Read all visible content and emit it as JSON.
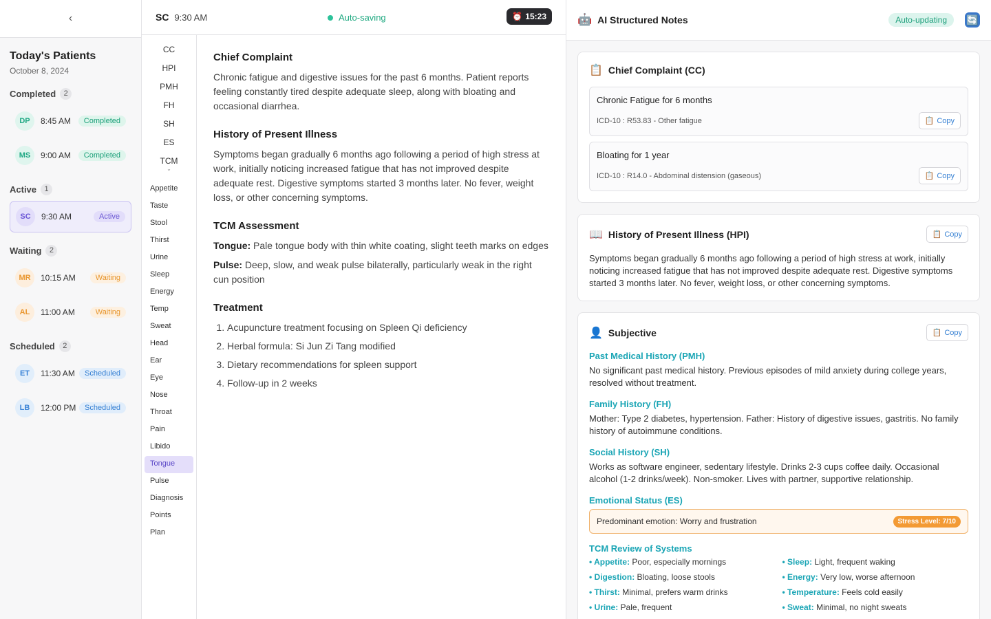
{
  "sidebar": {
    "collapse_glyph": "‹",
    "title": "Today's Patients",
    "date": "October 8, 2024",
    "groups": [
      {
        "label": "Completed",
        "count": "2",
        "patients": [
          {
            "initials": "DP",
            "time": "8:45 AM",
            "status": "Completed"
          },
          {
            "initials": "MS",
            "time": "9:00 AM",
            "status": "Completed"
          }
        ]
      },
      {
        "label": "Active",
        "count": "1",
        "patients": [
          {
            "initials": "SC",
            "time": "9:30 AM",
            "status": "Active"
          }
        ]
      },
      {
        "label": "Waiting",
        "count": "2",
        "patients": [
          {
            "initials": "MR",
            "time": "10:15 AM",
            "status": "Waiting"
          },
          {
            "initials": "AL",
            "time": "11:00 AM",
            "status": "Waiting"
          }
        ]
      },
      {
        "label": "Scheduled",
        "count": "2",
        "patients": [
          {
            "initials": "ET",
            "time": "11:30 AM",
            "status": "Scheduled"
          },
          {
            "initials": "LB",
            "time": "12:00 PM",
            "status": "Scheduled"
          }
        ]
      }
    ]
  },
  "editor": {
    "patient_initials": "SC",
    "patient_time": "9:30 AM",
    "autosave_label": "Auto-saving",
    "timer_icon": "⏰",
    "timer_value": "15:23",
    "section_abbrs": [
      "CC",
      "HPI",
      "PMH",
      "FH",
      "SH",
      "ES",
      "TCM"
    ],
    "tcm_chevron": "⌄",
    "tcm_items": [
      "Appetite",
      "Taste",
      "Stool",
      "Thirst",
      "Urine",
      "Sleep",
      "Energy",
      "Temp",
      "Sweat",
      "Head",
      "Ear",
      "Eye",
      "Nose",
      "Throat",
      "Pain",
      "Libido",
      "Tongue",
      "Pulse",
      "Diagnosis",
      "Points",
      "Plan"
    ],
    "selected_item": "Tongue",
    "cc_heading": "Chief Complaint",
    "cc_text": "Chronic fatigue and digestive issues for the past 6 months. Patient reports feeling constantly tired despite adequate sleep, along with bloating and occasional diarrhea.",
    "hpi_heading": "History of Present Illness",
    "hpi_text": "Symptoms began gradually 6 months ago following a period of high stress at work, initially noticing increased fatigue that has not improved despite adequate rest. Digestive symptoms started 3 months later. No fever, weight loss, or other concerning symptoms.",
    "tcm_heading": "TCM Assessment",
    "tongue_label": "Tongue:",
    "tongue_text": " Pale tongue body with thin white coating, slight teeth marks on edges",
    "pulse_label": "Pulse:",
    "pulse_text": " Deep, slow, and weak pulse bilaterally, particularly weak in the right cun position",
    "treatment_heading": "Treatment",
    "treatment_items": [
      "Acupuncture treatment focusing on Spleen Qi deficiency",
      "Herbal formula: Si Jun Zi Tang modified",
      "Dietary recommendations for spleen support",
      "Follow-up in 2 weeks"
    ]
  },
  "notes": {
    "robot_icon": "🤖",
    "title": "AI Structured Notes",
    "status": "Auto-updating",
    "refresh_icon": "🔄",
    "copy_icon": "📋",
    "copy_label": "Copy",
    "cc_card": {
      "icon": "📋",
      "title": "Chief Complaint (CC)",
      "items": [
        {
          "name": "Chronic Fatigue for 6 months",
          "code": "ICD-10 : R53.83 - Other fatigue"
        },
        {
          "name": "Bloating for 1 year",
          "code": "ICD-10 : R14.0 - Abdominal distension (gaseous)"
        }
      ]
    },
    "hpi_card": {
      "icon": "📖",
      "title": "History of Present Illness (HPI)",
      "text": "Symptoms began gradually 6 months ago following a period of high stress at work, initially noticing increased fatigue that has not improved despite adequate rest. Digestive symptoms started 3 months later. No fever, weight loss, or other concerning symptoms."
    },
    "subjective_card": {
      "icon": "👤",
      "title": "Subjective",
      "pmh_heading": "Past Medical History (PMH)",
      "pmh_text": "No significant past medical history. Previous episodes of mild anxiety during college years, resolved without treatment.",
      "fh_heading": "Family History (FH)",
      "fh_text": "Mother: Type 2 diabetes, hypertension. Father: History of digestive issues, gastritis. No family history of autoimmune conditions.",
      "sh_heading": "Social History (SH)",
      "sh_text": "Works as software engineer, sedentary lifestyle. Drinks 2-3 cups coffee daily. Occasional alcohol (1-2 drinks/week). Non-smoker. Lives with partner, supportive relationship.",
      "es_heading": "Emotional Status (ES)",
      "es_text": "Predominant emotion: Worry and frustration",
      "stress_label": "Stress Level: 7/10",
      "ros_heading": "TCM Review of Systems",
      "ros": [
        {
          "key": "Appetite:",
          "value": " Poor, especially mornings"
        },
        {
          "key": "Sleep:",
          "value": " Light, frequent waking"
        },
        {
          "key": "Digestion:",
          "value": " Bloating, loose stools"
        },
        {
          "key": "Energy:",
          "value": " Very low, worse afternoon"
        },
        {
          "key": "Thirst:",
          "value": " Minimal, prefers warm drinks"
        },
        {
          "key": "Temperature:",
          "value": " Feels cold easily"
        },
        {
          "key": "Urine:",
          "value": " Pale, frequent"
        },
        {
          "key": "Sweat:",
          "value": " Minimal, no night sweats"
        }
      ]
    }
  }
}
